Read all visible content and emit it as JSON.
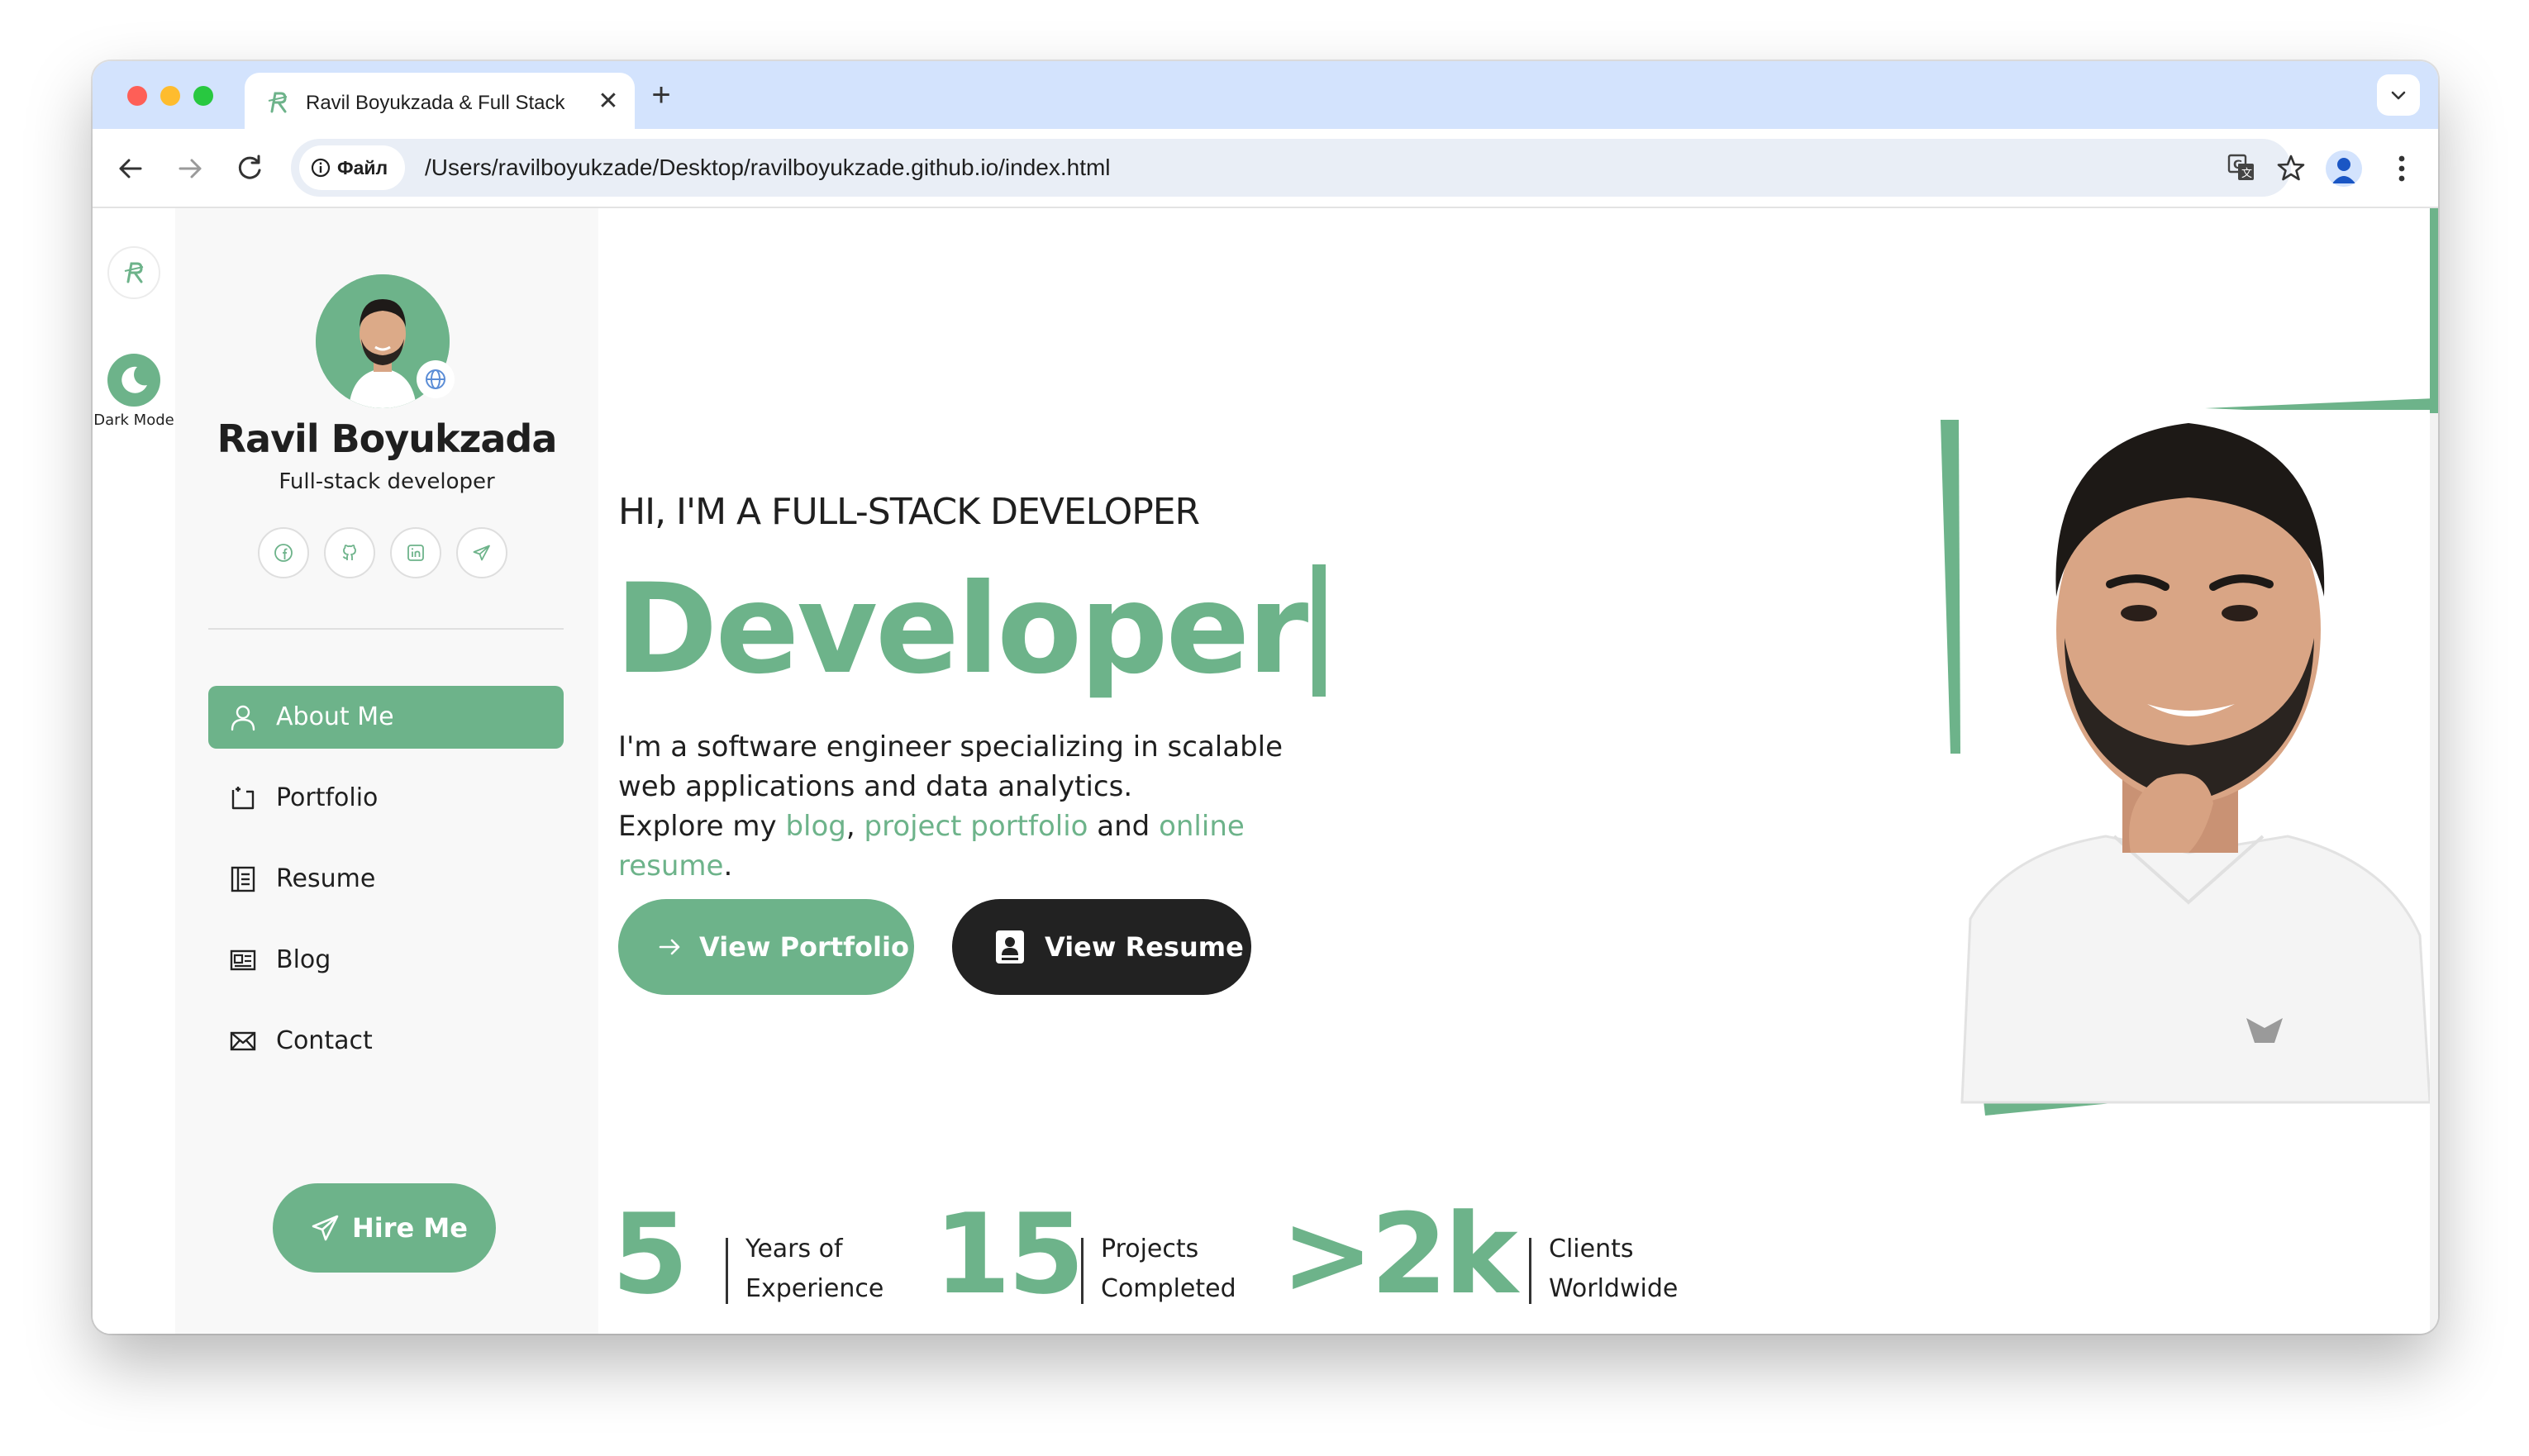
{
  "browser": {
    "tab_title": "Ravil Boyukzada & Full Stack",
    "close_symbol": "✕",
    "new_tab_symbol": "+",
    "site_chip_label": "Файл",
    "url": "/Users/ravilboyukzade/Desktop/ravilboyukzade.github.io/index.html"
  },
  "rail": {
    "dark_mode_label": "Dark Mode"
  },
  "sidebar": {
    "name": "Ravil Boyukzada",
    "role": "Full-stack developer",
    "social": [
      "facebook-icon",
      "github-icon",
      "linkedin-icon",
      "telegram-icon"
    ],
    "nav": [
      {
        "label": "About Me",
        "icon": "user-icon",
        "active": true
      },
      {
        "label": "Portfolio",
        "icon": "portfolio-icon",
        "active": false
      },
      {
        "label": "Resume",
        "icon": "resume-icon",
        "active": false
      },
      {
        "label": "Blog",
        "icon": "blog-icon",
        "active": false
      },
      {
        "label": "Contact",
        "icon": "envelope-icon",
        "active": false
      }
    ],
    "hire_label": "Hire Me"
  },
  "hero": {
    "subtitle": "HI, I'M A FULL-STACK DEVELOPER",
    "typed_word": "Developer",
    "desc_line1": "I'm a software engineer specializing in scalable web applications and data analytics.",
    "explore_prefix": "Explore my",
    "link_blog": "blog",
    "comma": ",",
    "link_portfolio": "project portfolio",
    "and_word": "and",
    "link_resume": "online resume",
    "period": ".",
    "btn_portfolio": "View Portfolio",
    "btn_resume": "View Resume"
  },
  "stats": [
    {
      "value": "5",
      "label_line1": "Years of",
      "label_line2": "Experience"
    },
    {
      "value": "15",
      "label_line1": "Projects",
      "label_line2": "Completed"
    },
    {
      "value": ">2k",
      "label_line1": "Clients",
      "label_line2": "Worldwide"
    }
  ],
  "colors": {
    "accent": "#6db38a",
    "dark_button": "#222222",
    "tab_strip": "#d3e3fd"
  }
}
